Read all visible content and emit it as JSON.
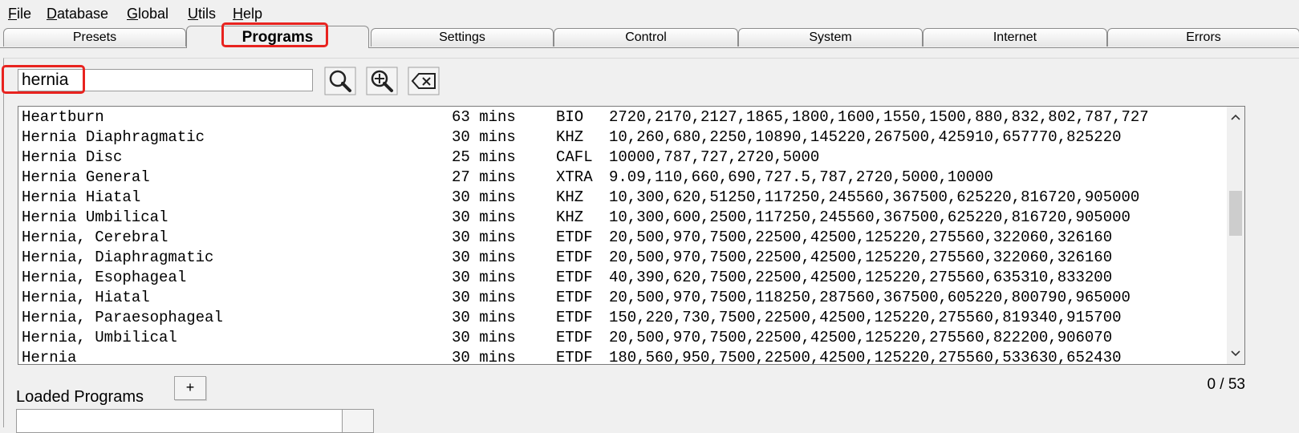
{
  "menu": [
    {
      "key": "F",
      "rest": "ile"
    },
    {
      "key": "D",
      "rest": "atabase"
    },
    {
      "key": "G",
      "rest": "lobal"
    },
    {
      "key": "U",
      "rest": "tils"
    },
    {
      "key": "H",
      "rest": "elp"
    }
  ],
  "tabs": [
    "Presets",
    "Programs",
    "Settings",
    "Control",
    "System",
    "Internet",
    "Errors"
  ],
  "active_tab": "Programs",
  "search": {
    "value": "hernia"
  },
  "icons": {
    "search": "search-icon",
    "zoom": "zoom-in-icon",
    "clear": "clear-backspace-icon"
  },
  "programs": [
    {
      "name": "Heartburn",
      "duration": "63 mins",
      "type": "BIO",
      "freqs": "2720,2170,2127,1865,1800,1600,1550,1500,880,832,802,787,727"
    },
    {
      "name": "Hernia Diaphragmatic",
      "duration": "30 mins",
      "type": "KHZ",
      "freqs": "10,260,680,2250,10890,145220,267500,425910,657770,825220"
    },
    {
      "name": "Hernia Disc",
      "duration": "25 mins",
      "type": "CAFL",
      "freqs": "10000,787,727,2720,5000"
    },
    {
      "name": "Hernia General",
      "duration": "27 mins",
      "type": "XTRA",
      "freqs": "9.09,110,660,690,727.5,787,2720,5000,10000"
    },
    {
      "name": "Hernia Hiatal",
      "duration": "30 mins",
      "type": "KHZ",
      "freqs": "10,300,620,51250,117250,245560,367500,625220,816720,905000"
    },
    {
      "name": "Hernia Umbilical",
      "duration": "30 mins",
      "type": "KHZ",
      "freqs": "10,300,600,2500,117250,245560,367500,625220,816720,905000"
    },
    {
      "name": "Hernia, Cerebral",
      "duration": "30 mins",
      "type": "ETDF",
      "freqs": "20,500,970,7500,22500,42500,125220,275560,322060,326160"
    },
    {
      "name": "Hernia, Diaphragmatic",
      "duration": "30 mins",
      "type": "ETDF",
      "freqs": "20,500,970,7500,22500,42500,125220,275560,322060,326160"
    },
    {
      "name": "Hernia, Esophageal",
      "duration": "30 mins",
      "type": "ETDF",
      "freqs": "40,390,620,7500,22500,42500,125220,275560,635310,833200"
    },
    {
      "name": "Hernia, Hiatal",
      "duration": "30 mins",
      "type": "ETDF",
      "freqs": "20,500,970,7500,118250,287560,367500,605220,800790,965000"
    },
    {
      "name": "Hernia, Paraesophageal",
      "duration": "30 mins",
      "type": "ETDF",
      "freqs": "150,220,730,7500,22500,42500,125220,275560,819340,915700"
    },
    {
      "name": "Hernia, Umbilical",
      "duration": "30 mins",
      "type": "ETDF",
      "freqs": "20,500,970,7500,22500,42500,125220,275560,822200,906070"
    },
    {
      "name": "Hernia",
      "duration": "30 mins",
      "type": "ETDF",
      "freqs": "180,560,950,7500,22500,42500,125220,275560,533630,652430"
    }
  ],
  "add_button": "+",
  "loaded_label": "Loaded Programs",
  "counter": "0 / 53",
  "colors": {
    "highlight": "#e8231f",
    "background": "#f0f0f0"
  }
}
